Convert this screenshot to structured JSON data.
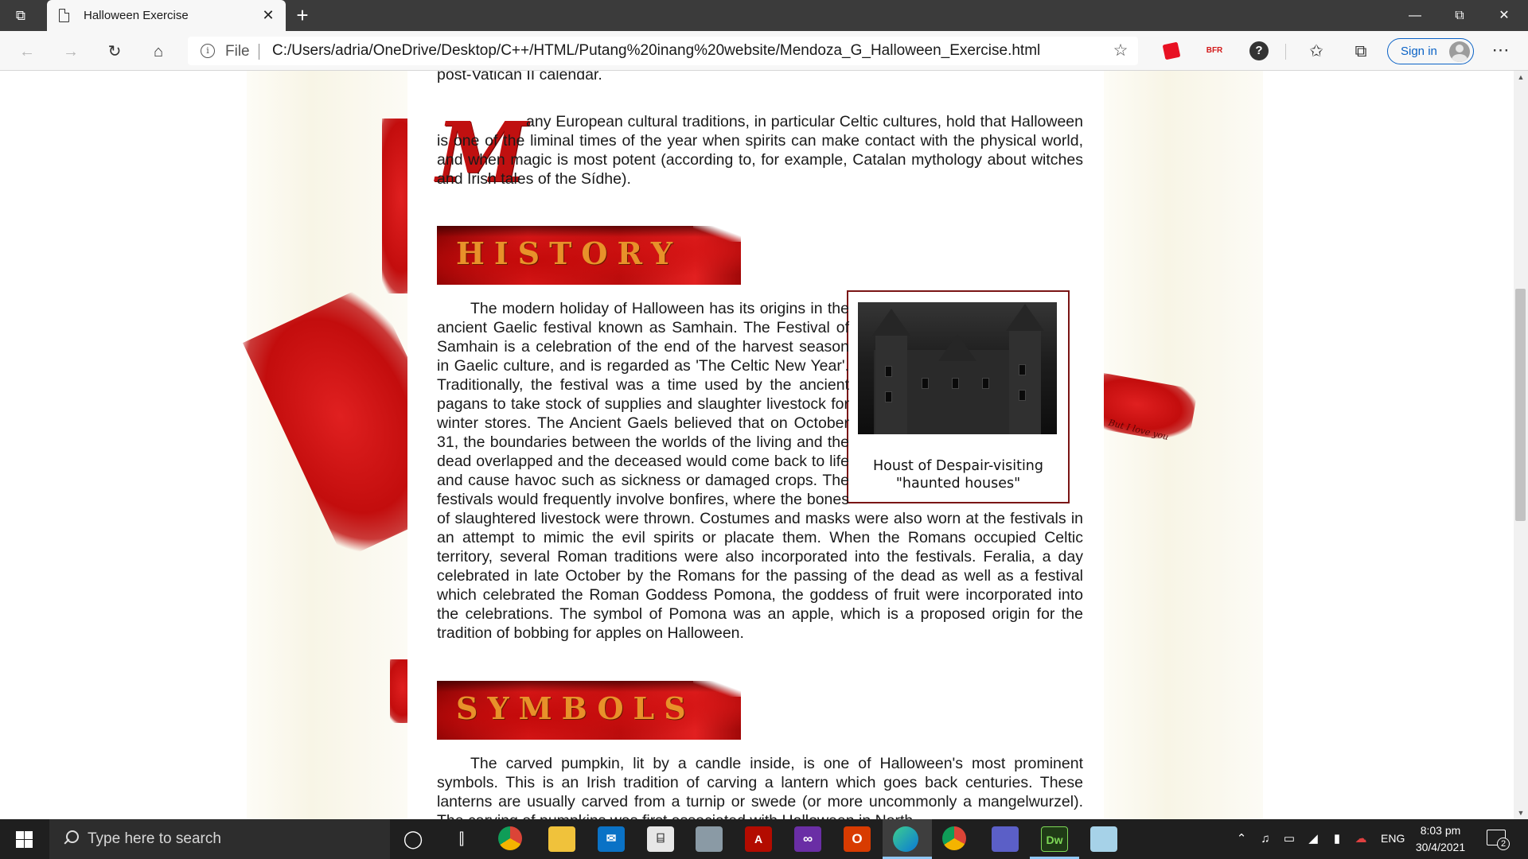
{
  "browser": {
    "tab_title": "Halloween Exercise",
    "address_prefix": "File",
    "url": "C:/Users/adria/OneDrive/Desktop/C++/HTML/Putang%20inang%20website/Mendoza_G_Halloween_Exercise.html",
    "sign_in_label": "Sign in",
    "extensions": [
      "red-extension",
      "bfr-extension",
      "help-extension"
    ],
    "accent_color": "#0a62c6"
  },
  "page": {
    "intro_tail": "post-Vatican II calendar.",
    "drop_cap": "M",
    "paragraph_celtic": "any European cultural traditions, in particular Celtic cultures, hold that Halloween is one of the liminal times of the year when spirits can make contact with the physical world, and when magic is most potent (according to, for example, Catalan mythology about witches and Irish tales of the Sídhe).",
    "history_heading": "HISTORY",
    "history_paragraph": "The modern holiday of Halloween has its origins in the ancient Gaelic festival known as Samhain. The Festival of Samhain is a celebration of the end of the harvest season in Gaelic culture, and is regarded as 'The Celtic New Year'. Traditionally, the festival was a time used by the ancient pagans to take stock of supplies and slaughter livestock for winter stores. The Ancient Gaels believed that on October 31, the boundaries between the worlds of the living and the dead overlapped and the deceased would come back to life and cause havoc such as sickness or damaged crops. The festivals would frequently involve bonfires, where the bones of slaughtered livestock were thrown. Costumes and masks were also worn at the festivals in an attempt to mimic the evil spirits or placate them. When the Romans occupied Celtic territory, several Roman traditions were also incorporated into the festivals. Feralia, a day celebrated in late October by the Romans for the passing of the dead as well as a festival which celebrated the Roman Goddess Pomona, the goddess of fruit were incorporated into the celebrations. The symbol of Pomona was an apple, which is a proposed origin for the tradition of bobbing for apples on Halloween.",
    "figure_caption": "Houst of Despair-visiting \"haunted houses\"",
    "symbols_heading": "SYMBOLS",
    "symbols_paragraph": "The carved pumpkin, lit by a candle inside, is one of Halloween's most prominent symbols. This is an Irish tradition of carving a lantern which goes back centuries. These lanterns are usually carved from a turnip or swede (or more uncommonly a mangelwurzel). The carving of pumpkins was first associated with Halloween in North",
    "blot_scrawl": "But I love you"
  },
  "taskbar": {
    "search_placeholder": "Type here to search",
    "pinned_apps": [
      "task-view",
      "chrome",
      "file-explorer",
      "mail",
      "store",
      "mixed-reality",
      "acrobat",
      "visual-studio",
      "office",
      "edge",
      "chrome-alt",
      "camera-app",
      "dreamweaver",
      "notepad"
    ],
    "language": "ENG",
    "time": "8:03 pm",
    "date": "30/4/2021",
    "notification_count": "2"
  }
}
